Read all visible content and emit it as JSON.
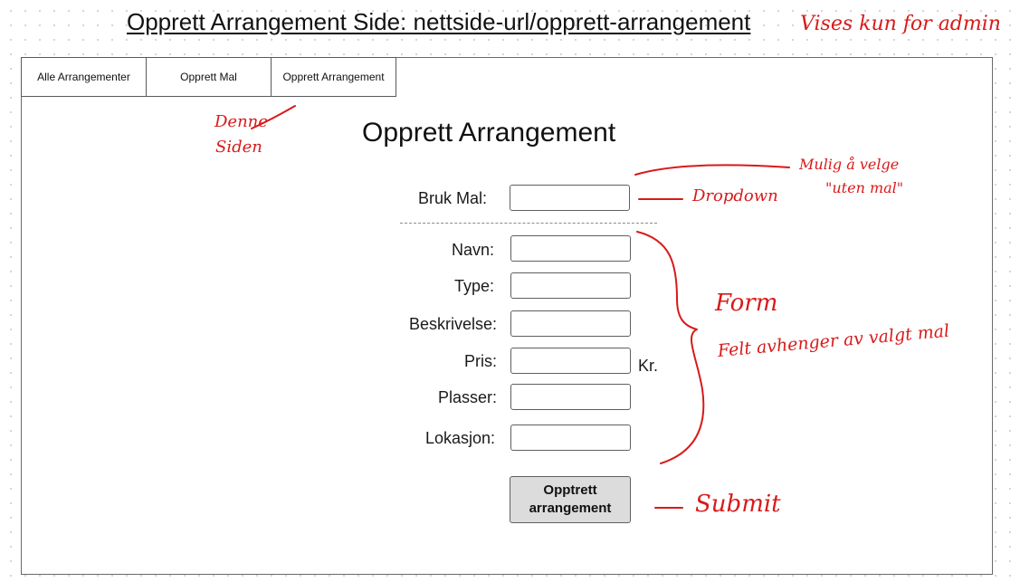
{
  "page": {
    "heading": "Opprett Arrangement Side: nettside-url/opprett-arrangement"
  },
  "tabs": [
    {
      "label": "Alle Arrangementer"
    },
    {
      "label": "Opprett Mal"
    },
    {
      "label": "Opprett Arrangement"
    }
  ],
  "form": {
    "title": "Opprett Arrangement",
    "template_label": "Bruk Mal:",
    "fields": {
      "navn": "Navn:",
      "type": "Type:",
      "beskrivelse": "Beskrivelse:",
      "pris": "Pris:",
      "plasser": "Plasser:",
      "lokasjon": "Lokasjon:"
    },
    "price_unit": "Kr.",
    "submit_label": "Opptrett arrangement"
  },
  "annotations": {
    "admin_only": "Vises kun for admin",
    "this_page_1": "Denne",
    "this_page_2": "Siden",
    "no_template_1": "Mulig å velge",
    "no_template_2": "\"uten mal\"",
    "dropdown": "Dropdown",
    "form": "Form",
    "fields_depend": "Felt avhenger av valgt mal",
    "submit": "Submit"
  },
  "colors": {
    "annotation": "#d81a1a",
    "button_bg": "#dcdcdc",
    "border": "#5f5f5f"
  }
}
